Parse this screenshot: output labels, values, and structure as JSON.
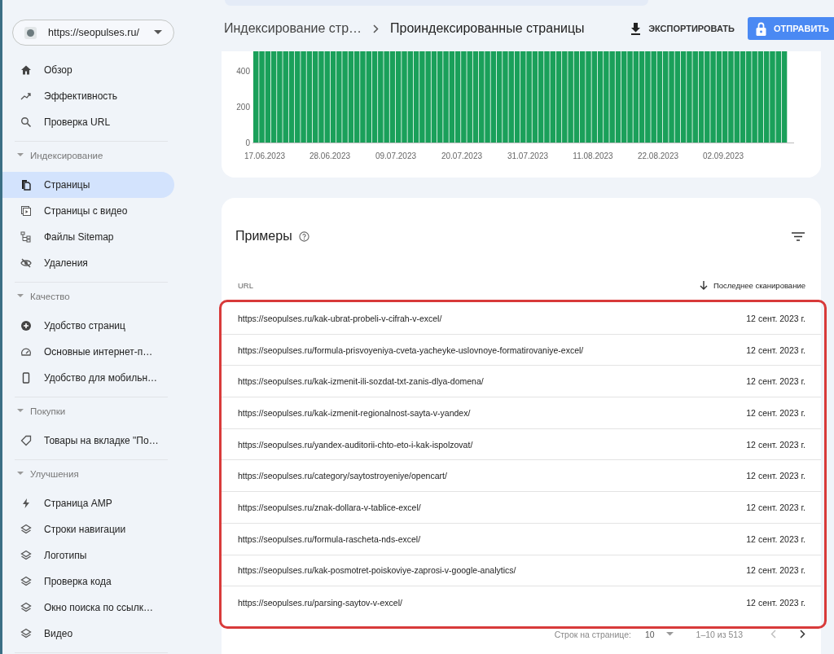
{
  "property_selector": {
    "value": "https://seopulses.ru/"
  },
  "sidebar": {
    "groups": [
      {
        "items": [
          {
            "label": "Обзор",
            "selected": false
          },
          {
            "label": "Эффективность",
            "selected": false
          },
          {
            "label": "Проверка URL",
            "selected": false
          }
        ]
      },
      {
        "header": "Индексирование",
        "expanded": true,
        "items": [
          {
            "label": "Страницы",
            "selected": true
          },
          {
            "label": "Страницы с видео",
            "selected": false
          },
          {
            "label": "Файлы Sitemap",
            "selected": false
          },
          {
            "label": "Удаления",
            "selected": false
          }
        ]
      },
      {
        "header": "Качество",
        "expanded": true,
        "items": [
          {
            "label": "Удобство страниц",
            "selected": false
          },
          {
            "label": "Основные интернет-п…",
            "selected": false
          },
          {
            "label": "Удобство для мобильн…",
            "selected": false
          }
        ]
      },
      {
        "header": "Покупки",
        "expanded": true,
        "items": [
          {
            "label": "Товары на вкладке \"По…",
            "selected": false
          }
        ]
      },
      {
        "header": "Улучшения",
        "expanded": true,
        "items": [
          {
            "label": "Страница AMP",
            "selected": false
          },
          {
            "label": "Строки навигации",
            "selected": false
          },
          {
            "label": "Логотипы",
            "selected": false
          },
          {
            "label": "Проверка кода",
            "selected": false
          },
          {
            "label": "Окно поиска по ссылк…",
            "selected": false
          },
          {
            "label": "Видео",
            "selected": false
          }
        ]
      }
    ]
  },
  "top_bar": {
    "breadcrumb": [
      "Индексирование стр…",
      "Проиндексированные страницы"
    ],
    "buttons": [
      {
        "label": "ЭКСПОРТИРОВАТЬ",
        "kind": "export"
      },
      {
        "label": "ОТПРАВИТЬ",
        "kind": "submit"
      }
    ]
  },
  "chart": {
    "y_labels": [
      "400",
      "200",
      "0"
    ],
    "x_labels": [
      "17.06.2023",
      "28.06.2023",
      "09.07.2023",
      "20.07.2023",
      "31.07.2023",
      "11.08.2023",
      "22.08.2023",
      "02.09.2023"
    ]
  },
  "examples": {
    "title": "Примеры",
    "highlighted": true,
    "columns": [
      {
        "label": "URL",
        "sorted": false
      },
      {
        "label": "Последнее сканирование",
        "sorted": true
      }
    ],
    "rows": [
      {
        "url": "https://seopulses.ru/kak-ubrat-probeli-v-cifrah-v-excel/",
        "date": "12 сент. 2023 г."
      },
      {
        "url": "https://seopulses.ru/formula-prisvoyeniya-cveta-yacheyke-uslovnoye-formatirovaniye-excel/",
        "date": "12 сент. 2023 г."
      },
      {
        "url": "https://seopulses.ru/kak-izmenit-ili-sozdat-txt-zanis-dlya-domena/",
        "date": "12 сент. 2023 г."
      },
      {
        "url": "https://seopulses.ru/kak-izmenit-regionalnost-sayta-v-yandex/",
        "date": "12 сент. 2023 г."
      },
      {
        "url": "https://seopulses.ru/yandex-auditorii-chto-eto-i-kak-ispolzovat/",
        "date": "12 сент. 2023 г."
      },
      {
        "url": "https://seopulses.ru/category/saytostroyeniye/opencart/",
        "date": "12 сент. 2023 г."
      },
      {
        "url": "https://seopulses.ru/znak-dollara-v-tablice-excel/",
        "date": "12 сент. 2023 г."
      },
      {
        "url": "https://seopulses.ru/formula-rascheta-nds-excel/",
        "date": "12 сент. 2023 г."
      },
      {
        "url": "https://seopulses.ru/kak-posmotret-poiskoviye-zaprosi-v-google-analytics/",
        "date": "12 сент. 2023 г."
      },
      {
        "url": "https://seopulses.ru/parsing-saytov-v-excel/",
        "date": "12 сент. 2023 г."
      }
    ],
    "pagination": {
      "rows_label": "Строк на странице:",
      "rows_per_page": "10",
      "range": "1–10 из 513"
    }
  }
}
